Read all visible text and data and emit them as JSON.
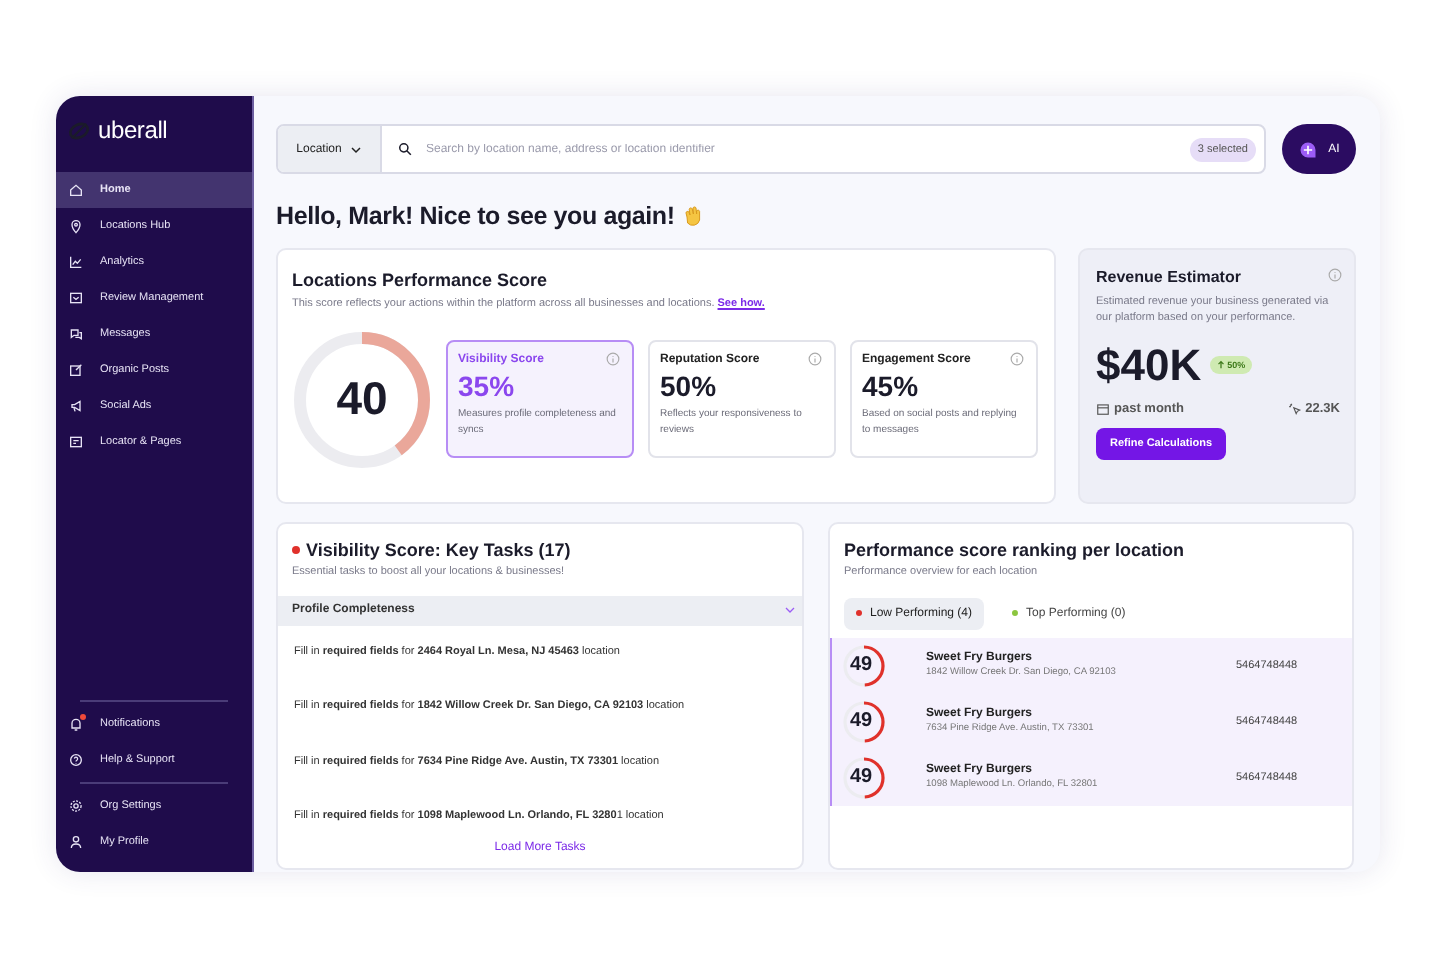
{
  "sidebar": {
    "logo": "uberall",
    "items": [
      {
        "label": "Home",
        "selected": true
      },
      {
        "label": "Locations Hub",
        "selected": false
      },
      {
        "label": "Analytics",
        "selected": false
      },
      {
        "label": "Review Management",
        "selected": false
      },
      {
        "label": "Messages",
        "selected": false
      },
      {
        "label": "Organic Posts",
        "selected": false
      },
      {
        "label": "Social Ads",
        "selected": false
      },
      {
        "label": "Locator & Pages",
        "selected": false
      }
    ],
    "bottom_items": [
      {
        "label": "Notifications",
        "badge": true
      },
      {
        "label": "Help & Support",
        "badge": false
      },
      {
        "label": "Org Settings",
        "badge": false
      },
      {
        "label": "My Profile",
        "badge": false
      }
    ]
  },
  "search": {
    "filter": "Location",
    "placeholder": "Search by location name, address or location identifier",
    "selected_count": "3 selected",
    "ai_button": "AI"
  },
  "greeting": "Hello, Mark! Nice to see you again!",
  "performance": {
    "title": "Locations Performance Score",
    "description": "This score reflects your actions within the platform across all businesses and locations.",
    "link": "See how.",
    "score": "40",
    "level": 0.4,
    "scores": [
      {
        "label": "Visibility Score",
        "value": "35%",
        "description": "Measures profile completeness and syncs",
        "selected": true
      },
      {
        "label": "Reputation Score",
        "value": "50%",
        "description": "Reflects your responsiveness to reviews",
        "selected": false
      },
      {
        "label": "Engagement Score",
        "value": "45%",
        "description": "Based on social posts and replying to messages",
        "selected": false
      }
    ]
  },
  "revenue": {
    "title": "Revenue Estimator",
    "description": "Estimated revenue your business generated via our platform based on your performance.",
    "amount": "$40K",
    "change": "50%",
    "period": "past month",
    "clicks": "22.3K",
    "button": "Refine Calculations"
  },
  "tasks": {
    "title": "Visibility Score: Key Tasks (17)",
    "subtitle": "Essential tasks to boost all your locations & businesses!",
    "section": "Profile Completeness",
    "expanded": true,
    "items": [
      "Fill in **required fields** for **2464 Royal Ln. Mesa, NJ 45463** location",
      "Fill in **required fields** for **1842 Willow Creek Dr. San Diego, CA 92103** location",
      "Fill in **required fields** for **7634 Pine Ridge Ave. Austin, TX 73301** location",
      "Fill in **required fields** for **1098 Maplewood Ln. Orlando, FL 3280**1 location"
    ],
    "load_more": "Load More Tasks"
  },
  "ranking": {
    "title": "Performance score ranking per location",
    "subtitle": "Performance overview for each location",
    "tabs": [
      {
        "label": "Low Performing (4)",
        "selected": true,
        "color": "#e0312b"
      },
      {
        "label": "Top Performing (0)",
        "selected": false,
        "color": "#8cc63f"
      }
    ],
    "rows": [
      {
        "score": "49",
        "level": 0.49,
        "name": "Sweet Fry Burgers",
        "address": "1842 Willow Creek Dr. San Diego, CA 92103",
        "phone": "5464748448"
      },
      {
        "score": "49",
        "level": 0.49,
        "name": "Sweet Fry Burgers",
        "address": "7634 Pine Ridge Ave. Austin, TX 73301",
        "phone": "5464748448"
      },
      {
        "score": "49",
        "level": 0.49,
        "name": "Sweet Fry Burgers",
        "address": "1098 Maplewood Ln. Orlando, FL 32801",
        "phone": "5464748448"
      }
    ]
  }
}
